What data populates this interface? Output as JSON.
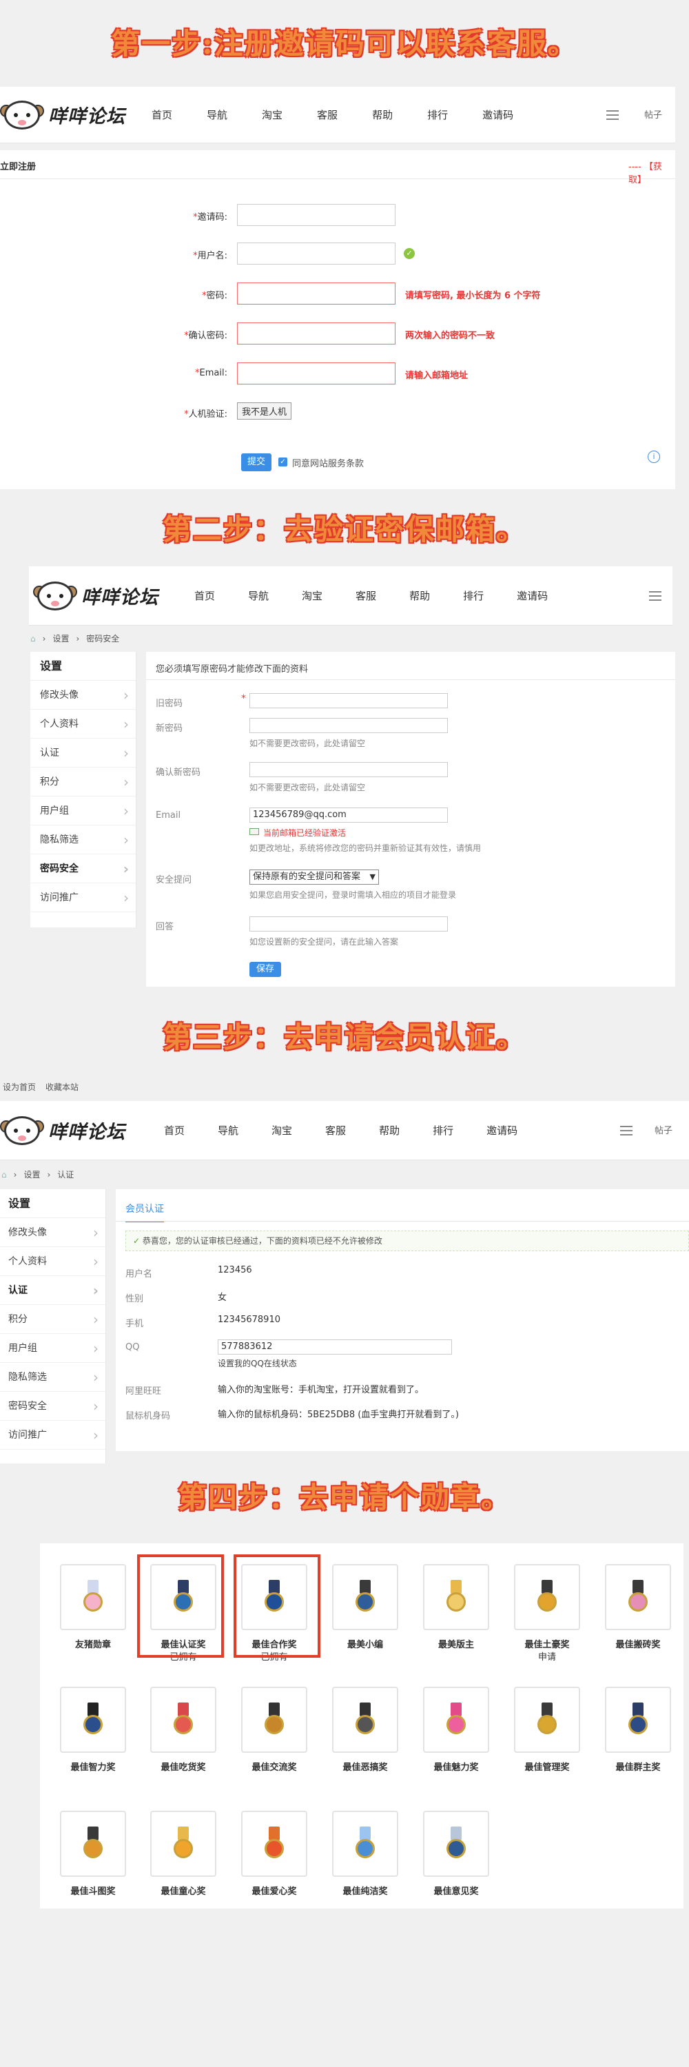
{
  "steps": [
    "第一步:注册邀请码可以联系客服。",
    "第二步：去验证密保邮箱。",
    "第三步：去申请会员认证。",
    "第四步：去申请个勋章。"
  ],
  "site": {
    "name": "咩咩论坛",
    "nav": [
      "首页",
      "导航",
      "淘宝",
      "客服",
      "帮助",
      "排行",
      "邀请码"
    ],
    "right_text": "帖子"
  },
  "register": {
    "section_title": "立即注册",
    "section_link": "---- 【获取】",
    "fields": [
      {
        "label": "邀请码:",
        "value": ""
      },
      {
        "label": "用户名:",
        "value": ""
      },
      {
        "label": "密码:",
        "value": ""
      },
      {
        "label": "确认密码:",
        "value": ""
      },
      {
        "label": "Email:",
        "value": ""
      }
    ],
    "errors": {
      "password": "请填写密码, 最小长度为 6 个字符",
      "confirm": "两次输入的密码不一致",
      "email": "请输入邮箱地址"
    },
    "captcha_label": "人机验证:",
    "captcha_button": "我不是人机",
    "submit": "提交",
    "agree": "同意网站服务条款"
  },
  "security": {
    "breadcrumb": [
      "设置",
      "密码安全"
    ],
    "sidebar_title": "设置",
    "sidebar": [
      "修改头像",
      "个人资料",
      "认证",
      "积分",
      "用户组",
      "隐私筛选",
      "密码安全",
      "访问推广"
    ],
    "active": 6,
    "notice": "您必须填写原密码才能修改下面的资料",
    "labels": {
      "old": "旧密码",
      "new": "新密码",
      "confirm": "确认新密码",
      "email": "Email",
      "question": "安全提问",
      "answer": "回答"
    },
    "hints": {
      "new": "如不需要更改密码，此处请留空",
      "confirm": "如不需要更改密码，此处请留空",
      "email_warn": "当前邮箱已经验证激活",
      "email_note": "如更改地址，系统将修改您的密码并重新验证其有效性，请慎用",
      "question": "如果您启用安全提问，登录时需填入相应的项目才能登录",
      "answer": "如您设置新的安全提问，请在此输入答案"
    },
    "email_value": "123456789@qq.com",
    "question_value": "保持原有的安全提问和答案",
    "save": "保存"
  },
  "cert": {
    "top_links": [
      "设为首页",
      "收藏本站"
    ],
    "breadcrumb": [
      "设置",
      "认证"
    ],
    "sidebar_title": "设置",
    "sidebar": [
      "修改头像",
      "个人资料",
      "认证",
      "积分",
      "用户组",
      "隐私筛选",
      "密码安全",
      "访问推广"
    ],
    "active": 2,
    "tab": "会员认证",
    "success": "恭喜您，您的认证审核已经通过，下面的资料项已经不允许被修改",
    "rows": [
      {
        "label": "用户名",
        "value": "123456"
      },
      {
        "label": "性别",
        "value": "女"
      },
      {
        "label": "手机",
        "value": "12345678910"
      },
      {
        "label": "QQ",
        "value": "577883612"
      },
      {
        "label": "阿里旺旺",
        "value": "输入你的淘宝账号：手机淘宝，打开设置就看到了。"
      },
      {
        "label": "鼠标机身码",
        "value": "输入你的鼠标机身码：5BE25DB8 (血手宝典打开就看到了。)"
      }
    ],
    "qq_note": "设置我的QQ在线状态"
  },
  "medals": [
    {
      "name": "友猪勋章",
      "sub": "",
      "rib": "#cfd8ef",
      "disc": "#f6b2c8"
    },
    {
      "name": "最佳认证奖",
      "sub": "已拥有",
      "rib": "#2c3e66",
      "disc": "#2d6fb5"
    },
    {
      "name": "最佳合作奖",
      "sub": "已拥有",
      "rib": "#2c3e66",
      "disc": "#1f4f98"
    },
    {
      "name": "最美小编",
      "sub": "",
      "rib": "#3a3a3a",
      "disc": "#2e5d9a"
    },
    {
      "name": "最美版主",
      "sub": "",
      "rib": "#e8b94a",
      "disc": "#f0cc6a"
    },
    {
      "name": "最佳土豪奖",
      "sub": "申请",
      "rib": "#3a3a3a",
      "disc": "#e2a42c"
    },
    {
      "name": "最佳搬砖奖",
      "sub": "",
      "rib": "#3a3a3a",
      "disc": "#e58fb7"
    },
    {
      "name": "最佳智力奖",
      "sub": "",
      "rib": "#222",
      "disc": "#2b4f8d"
    },
    {
      "name": "最佳吃货奖",
      "sub": "",
      "rib": "#d8484a",
      "disc": "#e45a50"
    },
    {
      "name": "最佳交流奖",
      "sub": "",
      "rib": "#333",
      "disc": "#c8862a"
    },
    {
      "name": "最佳恶搞奖",
      "sub": "",
      "rib": "#333",
      "disc": "#555"
    },
    {
      "name": "最佳魅力奖",
      "sub": "",
      "rib": "#e24a8a",
      "disc": "#ee5f9d"
    },
    {
      "name": "最佳管理奖",
      "sub": "",
      "rib": "#3a3a3a",
      "disc": "#d9a630"
    },
    {
      "name": "最佳群主奖",
      "sub": "",
      "rib": "#2c3e66",
      "disc": "#2d4c86"
    },
    {
      "name": "最佳斗图奖",
      "sub": "",
      "rib": "#3a3a3a",
      "disc": "#e0962c"
    },
    {
      "name": "最佳童心奖",
      "sub": "",
      "rib": "#e8b94a",
      "disc": "#f0a42c"
    },
    {
      "name": "最佳爱心奖",
      "sub": "",
      "rib": "#e2702a",
      "disc": "#e8552a"
    },
    {
      "name": "最佳纯洁奖",
      "sub": "",
      "rib": "#9bc4ef",
      "disc": "#4a8fd6"
    },
    {
      "name": "最佳意见奖",
      "sub": "",
      "rib": "#b8c6da",
      "disc": "#2f5a94"
    }
  ]
}
